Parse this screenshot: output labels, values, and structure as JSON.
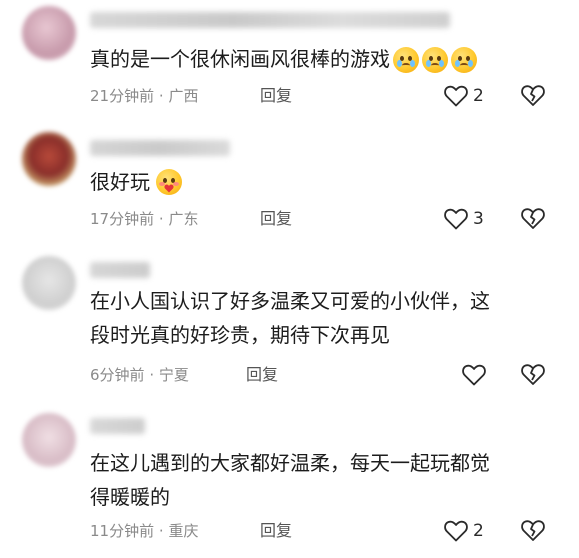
{
  "comments": [
    {
      "text": "真的是一个很休闲画风很棒的游戏",
      "emoji_count": 3,
      "emoji": "crying-face-icon",
      "time": "21分钟前",
      "location": "广西",
      "reply_label": "回复",
      "likes": "2"
    },
    {
      "text": "很好玩",
      "emoji_count": 1,
      "emoji": "hug-heart-face-icon",
      "time": "17分钟前",
      "location": "广东",
      "reply_label": "回复",
      "likes": "3"
    },
    {
      "text_lines": [
        "在小人国认识了好多温柔又可爱的小伙伴，这",
        "段时光真的好珍贵，期待下次再见"
      ],
      "time": "6分钟前",
      "location": "宁夏",
      "reply_label": "回复",
      "likes": ""
    },
    {
      "text_lines": [
        "在这儿遇到的大家都好温柔，每天一起玩都觉",
        "得暖暖的"
      ],
      "time": "11分钟前",
      "location": "重庆",
      "reply_label": "回复",
      "likes": "2"
    }
  ],
  "meta_separator": "·",
  "colors": {
    "text": "#1c1c1c",
    "meta": "#8a8a8a",
    "reply": "#555555",
    "icon": "#2a2a2a"
  }
}
